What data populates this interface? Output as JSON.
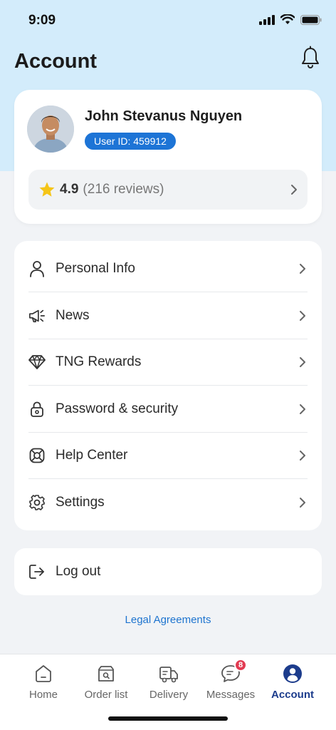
{
  "status_bar": {
    "time": "9:09"
  },
  "header": {
    "title": "Account"
  },
  "profile": {
    "name": "John Stevanus Nguyen",
    "user_id": "User ID: 459912",
    "rating": "4.9",
    "reviews": "(216 reviews)"
  },
  "menu": {
    "items": [
      {
        "label": "Personal Info",
        "icon": "person-icon"
      },
      {
        "label": "News",
        "icon": "megaphone-icon"
      },
      {
        "label": "TNG Rewards",
        "icon": "diamond-icon"
      },
      {
        "label": "Password & security",
        "icon": "lock-icon"
      },
      {
        "label": "Help Center",
        "icon": "lifebuoy-icon"
      },
      {
        "label": "Settings",
        "icon": "gear-icon"
      }
    ]
  },
  "logout": {
    "label": "Log out"
  },
  "legal": {
    "label": "Legal Agreements"
  },
  "bottom_nav": {
    "items": [
      {
        "label": "Home"
      },
      {
        "label": "Order list"
      },
      {
        "label": "Delivery"
      },
      {
        "label": "Messages",
        "badge": "8"
      },
      {
        "label": "Account"
      }
    ],
    "active": "Account"
  },
  "colors": {
    "header_bg": "#d3ecfb",
    "accent": "#1d74d6",
    "active_nav": "#1c3c8c",
    "badge": "#e23b52"
  }
}
